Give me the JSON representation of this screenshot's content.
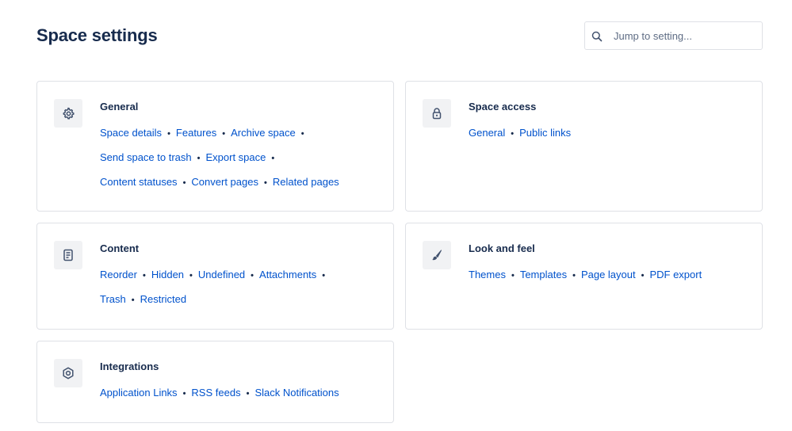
{
  "page": {
    "title": "Space settings"
  },
  "search": {
    "placeholder": "Jump to setting..."
  },
  "cards": {
    "general": {
      "title": "General",
      "icon": "gear-icon",
      "links": [
        "Space details",
        "Features",
        "Archive space",
        "Send space to trash",
        "Export space",
        "Content statuses",
        "Convert pages",
        "Related pages"
      ]
    },
    "space_access": {
      "title": "Space access",
      "icon": "lock-icon",
      "links": [
        "General",
        "Public links"
      ]
    },
    "content": {
      "title": "Content",
      "icon": "document-icon",
      "links": [
        "Reorder",
        "Hidden",
        "Undefined",
        "Attachments",
        "Trash",
        "Restricted"
      ]
    },
    "look_and_feel": {
      "title": "Look and feel",
      "icon": "paintbrush-icon",
      "links": [
        "Themes",
        "Templates",
        "Page layout",
        "PDF export"
      ]
    },
    "integrations": {
      "title": "Integrations",
      "icon": "hexagon-icon",
      "links": [
        "Application Links",
        "RSS feeds",
        "Slack Notifications"
      ]
    }
  },
  "colors": {
    "link": "#0052cc",
    "text": "#172b4d",
    "border": "#dfe1e6",
    "icon_bg": "#f1f2f4"
  }
}
